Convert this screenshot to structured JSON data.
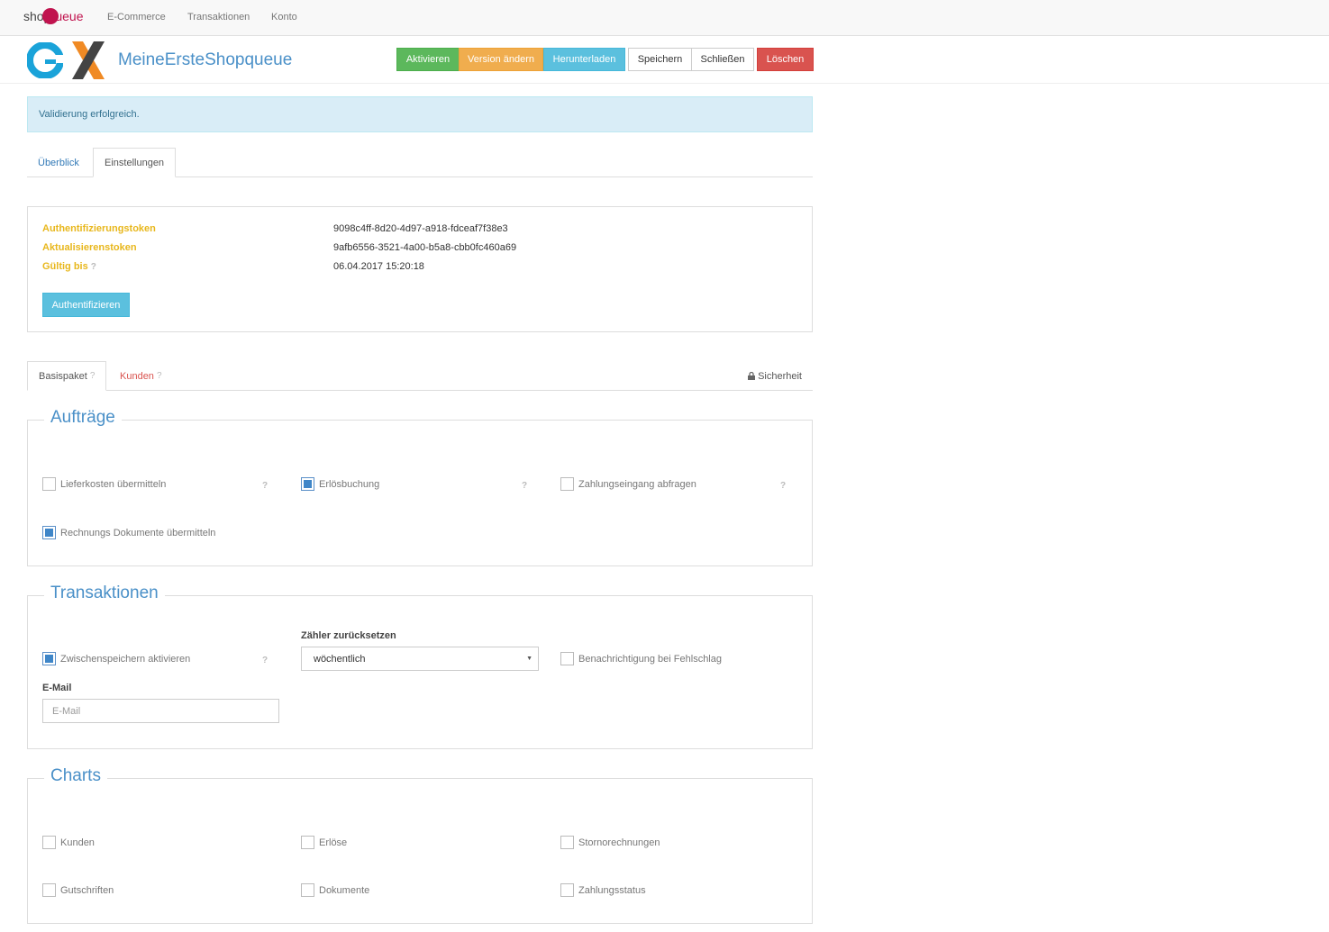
{
  "topnav": {
    "brand_part1": "shop",
    "brand_part2": "ueue",
    "items": [
      "E-Commerce",
      "Transaktionen",
      "Konto"
    ]
  },
  "header": {
    "app_name": "MeineErsteShopqueue",
    "buttons": {
      "activate": "Aktivieren",
      "change_version": "Version ändern",
      "download": "Herunterladen",
      "save": "Speichern",
      "close": "Schließen",
      "delete": "Löschen"
    }
  },
  "alert": {
    "text": "Validierung erfolgreich."
  },
  "main_tabs": [
    {
      "label": "Überblick",
      "active": false
    },
    {
      "label": "Einstellungen",
      "active": true
    }
  ],
  "token_panel": {
    "rows": [
      {
        "label": "Authentifizierungstoken",
        "value": "9098c4ff-8d20-4d97-a918-fdceaf7f38e3"
      },
      {
        "label": "Aktualisierenstoken",
        "value": "9afb6556-3521-4a00-b5a8-cbb0fc460a69"
      },
      {
        "label": "Gültig bis",
        "value": "06.04.2017 15:20:18"
      }
    ],
    "help_mark": "?",
    "auth_button": "Authentifizieren"
  },
  "sub_tabs": {
    "basispaket": "Basispaket",
    "kunden": "Kunden",
    "sicherheit": "Sicherheit",
    "help_mark": "?"
  },
  "auftraege": {
    "legend": "Aufträge",
    "options": [
      {
        "label": "Lieferkosten übermitteln",
        "checked": false
      },
      {
        "label": "Erlösbuchung",
        "checked": true
      },
      {
        "label": "Zahlungseingang abfragen",
        "checked": false
      },
      {
        "label": "Rechnungs Dokumente übermitteln",
        "checked": true
      }
    ]
  },
  "transaktionen": {
    "legend": "Transaktionen",
    "cache_label": "Zwischenspeichern aktivieren",
    "cache_checked": true,
    "reset_label": "Zähler zurücksetzen",
    "reset_value": "wöchentlich",
    "notify_label": "Benachrichtigung bei Fehlschlag",
    "notify_checked": false,
    "email_label": "E-Mail",
    "email_placeholder": "E-Mail",
    "email_value": ""
  },
  "charts": {
    "legend": "Charts",
    "options": [
      {
        "label": "Kunden",
        "checked": false
      },
      {
        "label": "Erlöse",
        "checked": false
      },
      {
        "label": "Stornorechnungen",
        "checked": false
      },
      {
        "label": "Gutschriften",
        "checked": false
      },
      {
        "label": "Dokumente",
        "checked": false
      },
      {
        "label": "Zahlungsstatus",
        "checked": false
      }
    ]
  },
  "help_mark": "?",
  "colors": {
    "accent_blue": "#4a90c8",
    "label_gold": "#e8b71c",
    "brand_magenta": "#c0134e",
    "success": "#5cb85c",
    "warning": "#f0ad4e",
    "info": "#5bc0de",
    "danger": "#d9534f"
  }
}
